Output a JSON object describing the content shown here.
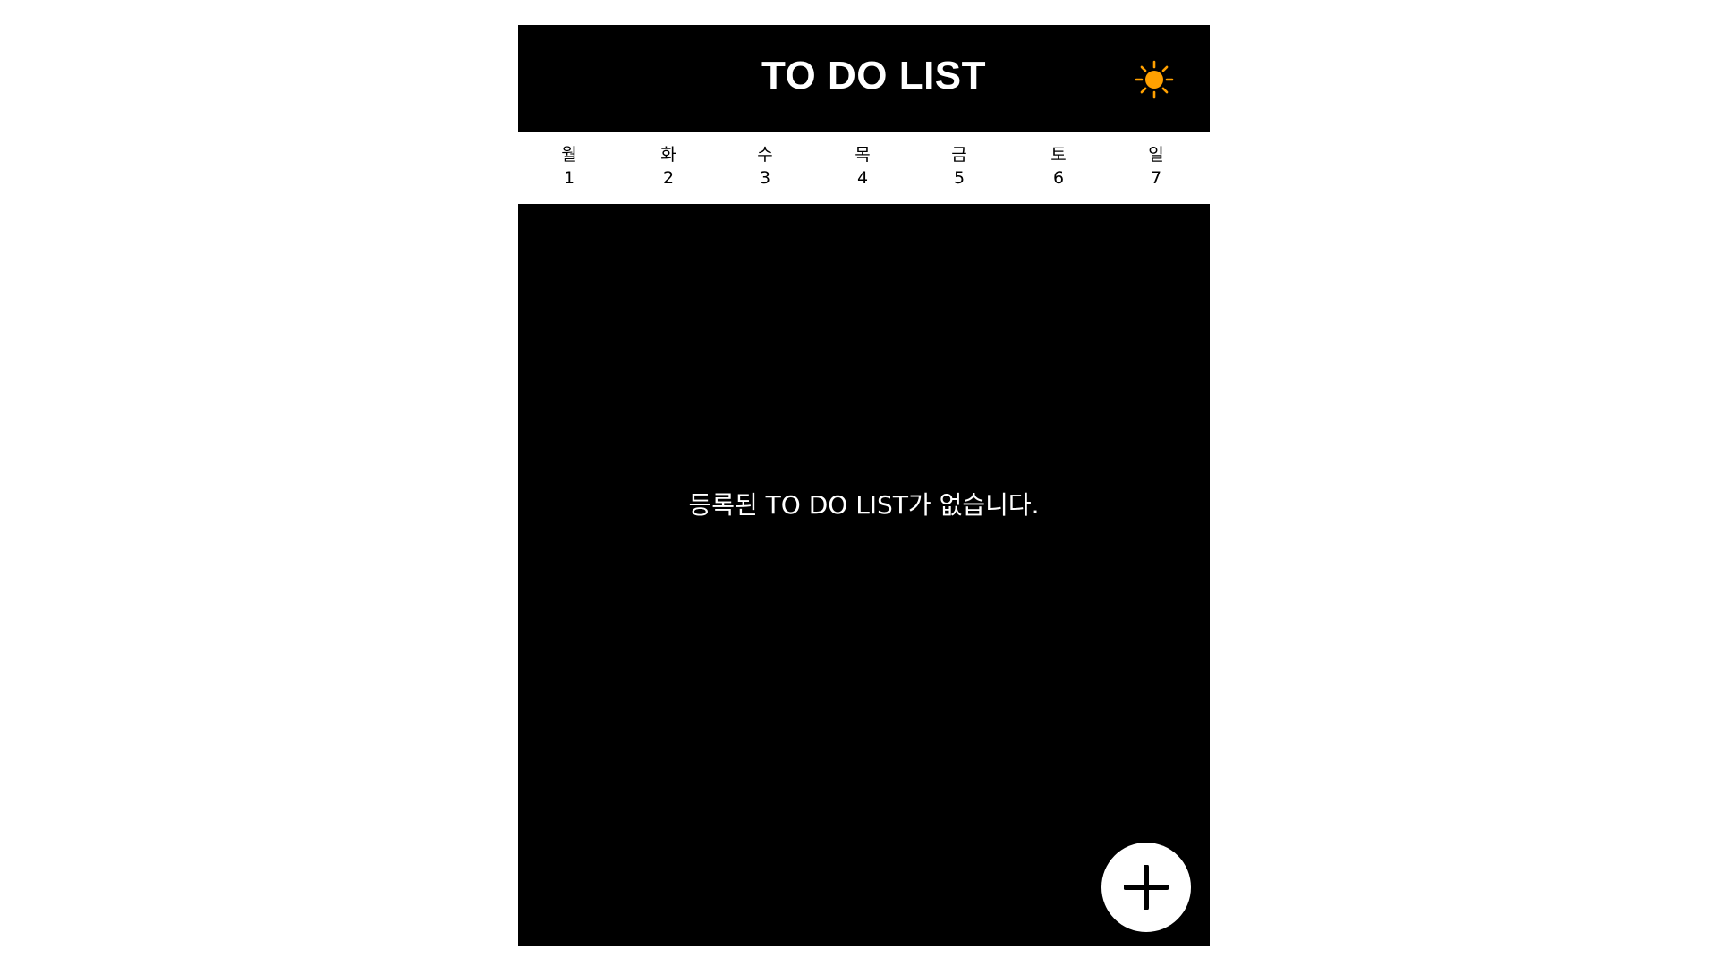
{
  "header": {
    "title": "TO DO LIST",
    "theme_icon": "sun-icon",
    "theme_icon_color": "#FFA000"
  },
  "week": {
    "days": [
      {
        "name": "월",
        "date": "1"
      },
      {
        "name": "화",
        "date": "2"
      },
      {
        "name": "수",
        "date": "3"
      },
      {
        "name": "목",
        "date": "4"
      },
      {
        "name": "금",
        "date": "5"
      },
      {
        "name": "토",
        "date": "6"
      },
      {
        "name": "일",
        "date": "7"
      }
    ]
  },
  "main": {
    "empty_message": "등록된 TO DO LIST가 없습니다."
  },
  "fab": {
    "icon": "plus-icon"
  },
  "colors": {
    "background": "#000000",
    "week_bar": "#FFFFFF",
    "accent": "#FFA000"
  }
}
